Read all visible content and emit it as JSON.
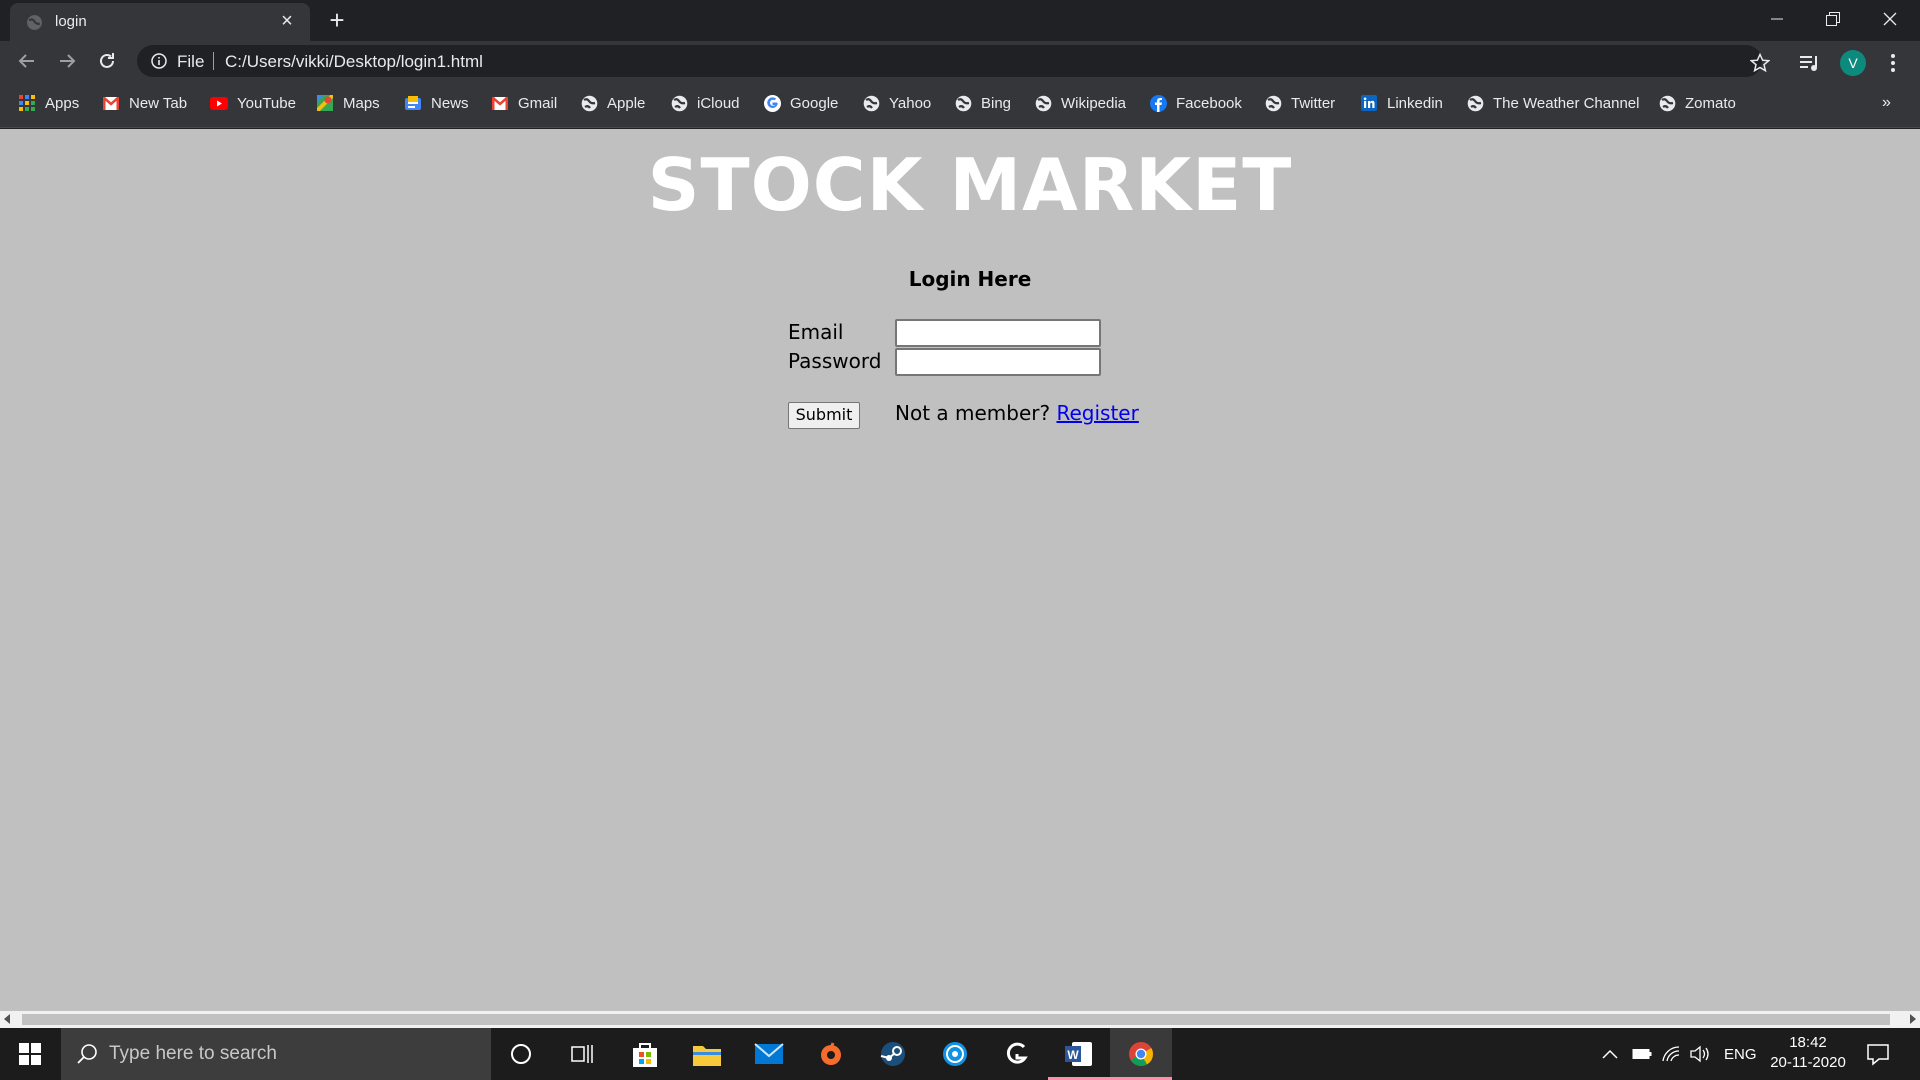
{
  "browser": {
    "tab_title": "login",
    "scheme_label": "File",
    "url": "C:/Users/vikki/Desktop/login1.html",
    "profile_initial": "V",
    "bookmarks": [
      {
        "label": "Apps",
        "icon": "apps-grid-icon"
      },
      {
        "label": "New Tab",
        "icon": "gmail-icon"
      },
      {
        "label": "YouTube",
        "icon": "youtube-icon"
      },
      {
        "label": "Maps",
        "icon": "maps-icon"
      },
      {
        "label": "News",
        "icon": "news-icon"
      },
      {
        "label": "Gmail",
        "icon": "gmail-icon"
      },
      {
        "label": "Apple",
        "icon": "globe-icon"
      },
      {
        "label": "iCloud",
        "icon": "globe-icon"
      },
      {
        "label": "Google",
        "icon": "google-icon"
      },
      {
        "label": "Yahoo",
        "icon": "globe-icon"
      },
      {
        "label": "Bing",
        "icon": "globe-icon"
      },
      {
        "label": "Wikipedia",
        "icon": "globe-icon"
      },
      {
        "label": "Facebook",
        "icon": "facebook-icon"
      },
      {
        "label": "Twitter",
        "icon": "globe-icon"
      },
      {
        "label": "Linkedin",
        "icon": "linkedin-icon"
      },
      {
        "label": "The Weather Channel",
        "icon": "globe-icon"
      },
      {
        "label": "Zomato",
        "icon": "globe-icon"
      }
    ],
    "more_bookmarks": "»"
  },
  "page": {
    "title": "STOCK MARKET",
    "login_heading": "Login Here",
    "email_label": "Email",
    "password_label": "Password",
    "submit_label": "Submit",
    "not_member_text": "Not a member? ",
    "register_label": "Register"
  },
  "taskbar": {
    "search_placeholder": "Type here to search",
    "language": "ENG",
    "time": "18:42",
    "date": "20-11-2020"
  },
  "colors": {
    "page_background": "#c0c0c0",
    "title_color": "#ffffff",
    "link_color": "#0000ee",
    "chrome_dark": "#202124",
    "chrome_toolbar": "#35363a",
    "taskbar": "#1c1c1c"
  }
}
